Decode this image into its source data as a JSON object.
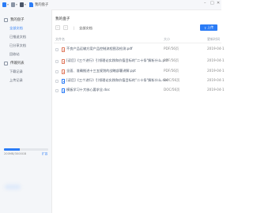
{
  "titlebar": {
    "title": "我的盘子"
  },
  "sidebar": {
    "sections": [
      {
        "label": "我的盘子",
        "icon": "cloud-icon",
        "items": [
          {
            "label": "全部文档",
            "active": true
          },
          {
            "label": "已推送文档",
            "active": false
          },
          {
            "label": "已分享文档",
            "active": false
          },
          {
            "label": "回收站",
            "active": false
          }
        ]
      },
      {
        "label": "传输列表",
        "icon": "transfer-icon",
        "items": [
          {
            "label": "下载记录",
            "active": false
          },
          {
            "label": "上传记录",
            "active": false
          }
        ]
      }
    ],
    "storage": {
      "text": "200MB/3000GB",
      "fraction": 0.35,
      "expand_label": "扩容"
    }
  },
  "main": {
    "title": "我的盘子",
    "breadcrumb": "全部文档",
    "upload_label": "上传",
    "columns": [
      "文件名",
      "大小",
      "更新时间"
    ],
    "files": [
      {
        "name": "不良产品运输方案产品控制流程图及检测.pdf",
        "size": "PDF/56页",
        "date": "2019-04-1",
        "type": "pdf"
      },
      {
        "name": "[读后]《三个进行》引领理论实践和价值目标的\"二十条\"解析什么.pdf",
        "size": "PDF/56页",
        "date": "2019-04-1",
        "type": "pdf"
      },
      {
        "name": "全面、准确推进十三五规划的战略部署讲解.ppt",
        "size": "PDF/56页",
        "date": "2019-04-1",
        "type": "pdf"
      },
      {
        "name": "[读后]《三个进行》引领理论实践和价值目标的\"二十条\"解析什么.doc",
        "size": "DOC/56页",
        "date": "2019-04-1",
        "type": "doc"
      },
      {
        "name": "模板学习十大核心要求全.doc",
        "size": "DOC/56页",
        "date": "2019-04-1",
        "type": "doc"
      }
    ]
  },
  "colors": {
    "accent": "#2b7cf6"
  }
}
